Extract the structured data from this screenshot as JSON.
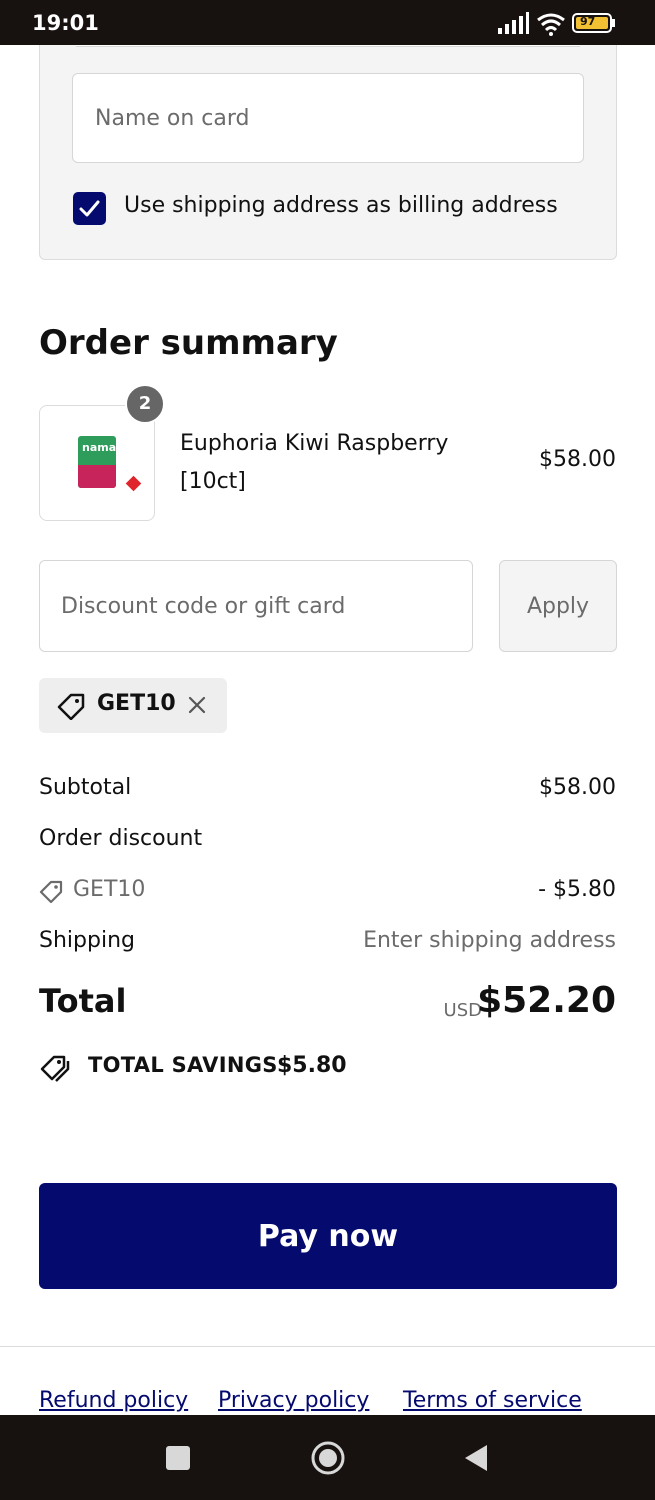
{
  "status_bar": {
    "time": "19:01",
    "battery": "97",
    "icons": [
      "signal-icon",
      "wifi-icon",
      "battery-icon"
    ]
  },
  "billing": {
    "name_placeholder": "Name on card",
    "checkbox_checked": true,
    "checkbox_label": "Use shipping address as billing address"
  },
  "order_summary": {
    "title": "Order summary",
    "items": [
      {
        "name": "Euphoria Kiwi Raspberry [10ct]",
        "price": "$58.00",
        "quantity": "2",
        "image_text": "nama"
      }
    ]
  },
  "discount": {
    "placeholder": "Discount code or gift card",
    "apply_label": "Apply",
    "applied_code": "GET10"
  },
  "totals": {
    "subtotal_label": "Subtotal",
    "subtotal_value": "$58.00",
    "order_discount_label": "Order discount",
    "discount_code": "GET10",
    "discount_value": "- $5.80",
    "shipping_label": "Shipping",
    "shipping_value": "Enter shipping address",
    "total_label": "Total",
    "currency": "USD",
    "total_value": "$52.20",
    "savings_label": "TOTAL SAVINGS",
    "savings_value": "$5.80"
  },
  "pay_button": "Pay now",
  "footer_links": [
    "Refund policy",
    "Privacy policy",
    "Terms of service"
  ],
  "colors": {
    "accent": "#050a6e",
    "muted_text": "#6b6b6b",
    "panel_bg": "#f4f4f4",
    "system_bar": "#17110f"
  }
}
